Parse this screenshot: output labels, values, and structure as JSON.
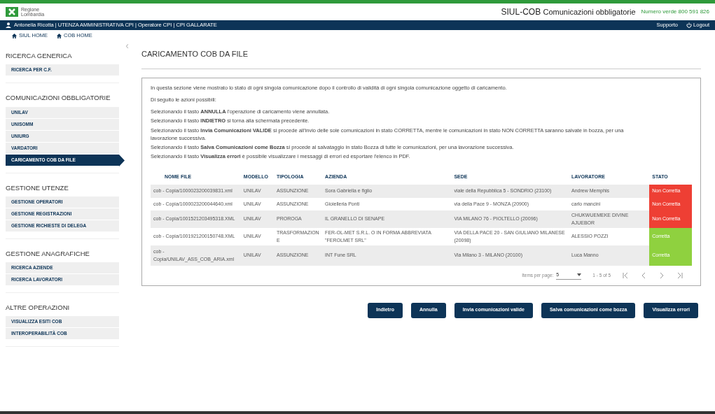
{
  "header": {
    "logo_line1": "Regione",
    "logo_line2": "Lombardia",
    "title_bold": "SIUL-COB",
    "title_rest": "Comunicazioni obbligatorie",
    "phone": "Numero verde 800 591 826"
  },
  "user_bar": {
    "user": "Antonella Ricotta | UTENZA AMMINISTRATIVA CPI | Operatore CPI | CPI GALLARATE",
    "links": [
      "Supporto",
      "Logout"
    ]
  },
  "breadcrumbs": [
    "SIUL HOME",
    "COB HOME"
  ],
  "collapse": "‹",
  "sidebar": [
    {
      "title": "RICERCA GENERICA",
      "items": [
        {
          "label": "RICERCA PER C.F.",
          "selected": false
        }
      ]
    },
    {
      "title": "COMUNICAZIONI OBBLIGATORIE",
      "items": [
        {
          "label": "UNILAV",
          "selected": false
        },
        {
          "label": "UNISOMM",
          "selected": false
        },
        {
          "label": "UNIURG",
          "selected": false
        },
        {
          "label": "VARDATORI",
          "selected": false
        },
        {
          "label": "CARICAMENTO COB DA FILE",
          "selected": true
        }
      ]
    },
    {
      "title": "GESTIONE UTENZE",
      "items": [
        {
          "label": "GESTIONE OPERATORI",
          "selected": false
        },
        {
          "label": "GESTIONE REGISTRAZIONI",
          "selected": false
        },
        {
          "label": "GESTIONE RICHIESTE DI DELEGA",
          "selected": false
        }
      ]
    },
    {
      "title": "GESTIONE ANAGRAFICHE",
      "items": [
        {
          "label": "RICERCA AZIENDE",
          "selected": false
        },
        {
          "label": "RICERCA LAVORATORI",
          "selected": false
        }
      ]
    },
    {
      "title": "ALTRE OPERAZIONI",
      "items": [
        {
          "label": "VISUALIZZA ESITI COB",
          "selected": false
        },
        {
          "label": "INTEROPERABILITÀ COB",
          "selected": false
        }
      ]
    }
  ],
  "page_title": "CARICAMENTO COB DA FILE",
  "intro": [
    "In questa sezione viene mostrato lo stato di ogni singola comunicazione dopo il controllo di validità di ogni singola comunicazione oggetto di caricamento.",
    "Di seguito le azioni possibili:"
  ],
  "actions_help": [
    "Selezionando il tasto **ANNULLA** l'operazione di caricamento viene annullata.",
    "Selezionando il tasto **INDIETRO** si torna alla schermata precedente.",
    "Selezionando il tasto **Invia Comunicazioni VALIDE** si procede all'invio delle sole comunicazioni in stato CORRETTA, mentre le comunicazioni in stato NON CORRETTA saranno salvate in bozza, per una lavorazione successiva.",
    "Selezionando il tasto **Salva Comunicazioni come Bozza** si procede al salvataggio in stato Bozza di tutte le comunicazioni, per una lavorazione successiva.",
    "Selezionando il tasto **Visualizza errori** è possibile visualizzare i messaggi di errori ed esportare l'elenco in PDF."
  ],
  "table": {
    "columns": [
      "NOME FILE",
      "MODELLO",
      "TIPOLOGIA",
      "AZIENDA",
      "SEDE",
      "LAVORATORE",
      "STATO"
    ],
    "rows": [
      {
        "cells": [
          "cob - Copia/1000023200039831.xml",
          "UNILAV",
          "ASSUNZIONE",
          "Sora Gabriella e figlio",
          "viale della Repubblica 5 - SONDRIO (23100)",
          "Andrew Memphis"
        ],
        "stato": "Non Corretta",
        "color": "#ee3f34"
      },
      {
        "cells": [
          "cob - Copia/1000023200044640.xml",
          "UNILAV",
          "ASSUNZIONE",
          "Gioielleria Ponti",
          "via della Pace 9 - MONZA (20900)",
          "carlo mancini"
        ],
        "stato": "Non Corretta",
        "color": "#ee3f34"
      },
      {
        "cells": [
          "cob - Copia/1001521203495318.XML",
          "UNILAV",
          "PROROGA",
          "IL GRANELLO DI SENAPE",
          "VIA MILANO 76 - PIOLTELLO (20096)",
          "CHUKWUEMEKE DIVINE AJUEBOR"
        ],
        "stato": "Non Corretta",
        "color": "#ee3f34"
      },
      {
        "cells": [
          "cob - Copia/1001921200150748.XML",
          "UNILAV",
          "TRASFORMAZIONE",
          "FER-OL-MET S.R.L. O IN FORMA ABBREVIATA \"FEROLMET SRL\"",
          "VIA DELLA PACE 20 - SAN GIULIANO MILANESE (20098)",
          "ALESSIO POZZI"
        ],
        "stato": "Corretta",
        "color": "#8fd13f"
      },
      {
        "cells": [
          "cob - Copia/UNILAV_ASS_COB_ARIA.xml",
          "UNILAV",
          "ASSUNZIONE",
          "INT Fune SRL",
          "Via Milano 3 - MILANO (20100)",
          "Luca Manno"
        ],
        "stato": "Corretta",
        "color": "#8fd13f"
      }
    ]
  },
  "paginator": {
    "items_per_page_label": "Items per page:",
    "items_per_page": "5",
    "range": "1 - 5 of 5"
  },
  "buttons": [
    "Indietro",
    "Annulla",
    "Invia comunicazioni valide",
    "Salva comunicazioni come bozza",
    "Visualizza errori"
  ]
}
